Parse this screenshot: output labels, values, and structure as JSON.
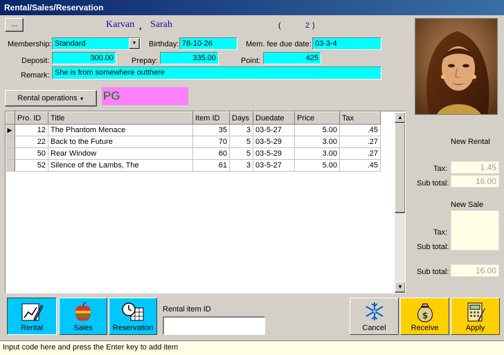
{
  "window": {
    "title": "Rental/Sales/Reservation"
  },
  "customer": {
    "more_button": "...",
    "last_name": "Karvan",
    "comma": ",",
    "first_name": "Sarah",
    "paren_open": "(",
    "count": "2",
    "paren_close": ")"
  },
  "form": {
    "membership_label": "Membership:",
    "membership_value": "Standard",
    "birthday_label": "Birthday:",
    "birthday_value": "78-10-26",
    "mem_fee_label": "Mem. fee due date:",
    "mem_fee_value": "03-3-4",
    "deposit_label": "Deposit:",
    "deposit_value": "300.00",
    "prepay_label": "Prepay:",
    "prepay_value": "335.00",
    "point_label": "Point:",
    "point_value": "425",
    "remark_label": "Remark:",
    "remark_value": "She is from somewhere outthere"
  },
  "operations": {
    "label": "Rental operations",
    "rating": "PG"
  },
  "table": {
    "columns": [
      "Pro. ID",
      "Title",
      "Item ID",
      "Days",
      "Duedate",
      "Price",
      "Tax"
    ],
    "rows": [
      [
        "12",
        "The Phantom Menace",
        "35",
        "3",
        "03-5-27",
        "5.00",
        ".45"
      ],
      [
        "22",
        "Back to the Future",
        "70",
        "5",
        "03-5-29",
        "3.00",
        ".27"
      ],
      [
        "50",
        "Rear Window",
        "60",
        "5",
        "03-5-29",
        "3.00",
        ".27"
      ],
      [
        "52",
        "Silence of the Lambs, The",
        "61",
        "3",
        "03-5-27",
        "5.00",
        ".45"
      ]
    ]
  },
  "summary": {
    "new_rental_title": "New Rental",
    "rental_tax_label": "Tax:",
    "rental_tax_value": "1.45",
    "rental_subtotal_label": "Sub total:",
    "rental_subtotal_value": "16.00",
    "new_sale_title": "New Sale",
    "sale_tax_label": "Tax:",
    "sale_subtotal_label": "Sub total:",
    "total_label": "Sub total:",
    "total_value": "16.00"
  },
  "toolbar": {
    "rental": "Rental",
    "sales": "Sales",
    "reservation": "Reservation",
    "rental_item_label": "Rental item ID",
    "cancel": "Cancel",
    "receive": "Receive",
    "apply": "Apply"
  },
  "status": {
    "text": "Input code here and press the Enter key to add item"
  },
  "colors": {
    "field_cyan": "#00ffff",
    "rating_pink": "#ff80ff",
    "rating_text": "#008000",
    "name_blue": "#1010a0",
    "active_tool": "#00c8ff",
    "gold_tool": "#ffd000"
  },
  "icons": {
    "rental": "chart-pen-icon",
    "sales": "apple-icon",
    "reservation": "clock-calendar-icon",
    "cancel": "snowflake-icon",
    "receive": "money-bag-icon",
    "apply": "calculator-icon",
    "photo": "customer-photo"
  }
}
